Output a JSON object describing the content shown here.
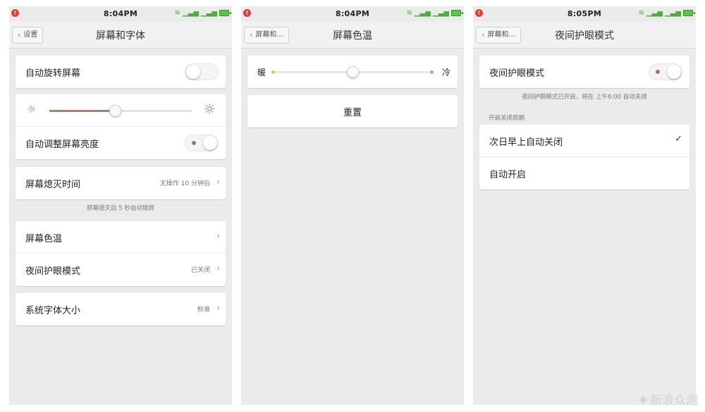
{
  "screens": [
    {
      "status": {
        "time": "8:04PM"
      },
      "nav": {
        "back": "设置",
        "title": "屏幕和字体"
      },
      "rows": {
        "auto_rotate": "自动旋转屏幕",
        "auto_brightness": "自动调整屏幕亮度",
        "screen_off": "屏幕熄灭时间",
        "screen_off_value": "无操作 10 分钟后",
        "color_temp": "屏幕色温",
        "night_mode": "夜间护眼模式",
        "night_mode_value": "已关闭",
        "font_size": "系统字体大小",
        "font_size_value": "标准"
      },
      "lock_note": "屏幕熄灭后 5 秒自动锁屏",
      "brightness": {
        "level": 0.46
      },
      "toggles": {
        "auto_rotate": false,
        "auto_brightness": true
      }
    },
    {
      "status": {
        "time": "8:04PM"
      },
      "nav": {
        "back": "屏幕和...",
        "title": "屏幕色温"
      },
      "warm_label": "暖",
      "cool_label": "冷",
      "reset_label": "重置",
      "temperature": {
        "level": 0.5
      }
    },
    {
      "status": {
        "time": "8:05PM"
      },
      "nav": {
        "back": "屏幕和...",
        "title": "夜间护眼模式"
      },
      "night_mode_label": "夜间护眼模式",
      "night_mode_note": "夜间护眼模式已开启，将在 上午6:00 自动关闭",
      "period_header": "开启关闭周期",
      "options": [
        {
          "label": "次日早上自动关闭",
          "selected": true
        },
        {
          "label": "自动开启",
          "selected": false
        }
      ],
      "toggle_on": true
    }
  ],
  "watermark": "新浪众测",
  "colors": {
    "brightness_fill": "#a5846a",
    "temp_warm": "#f0c060",
    "temp_cool": "#7fb6e8",
    "signal": "#4cae3a",
    "alert": "#e43b3b"
  }
}
